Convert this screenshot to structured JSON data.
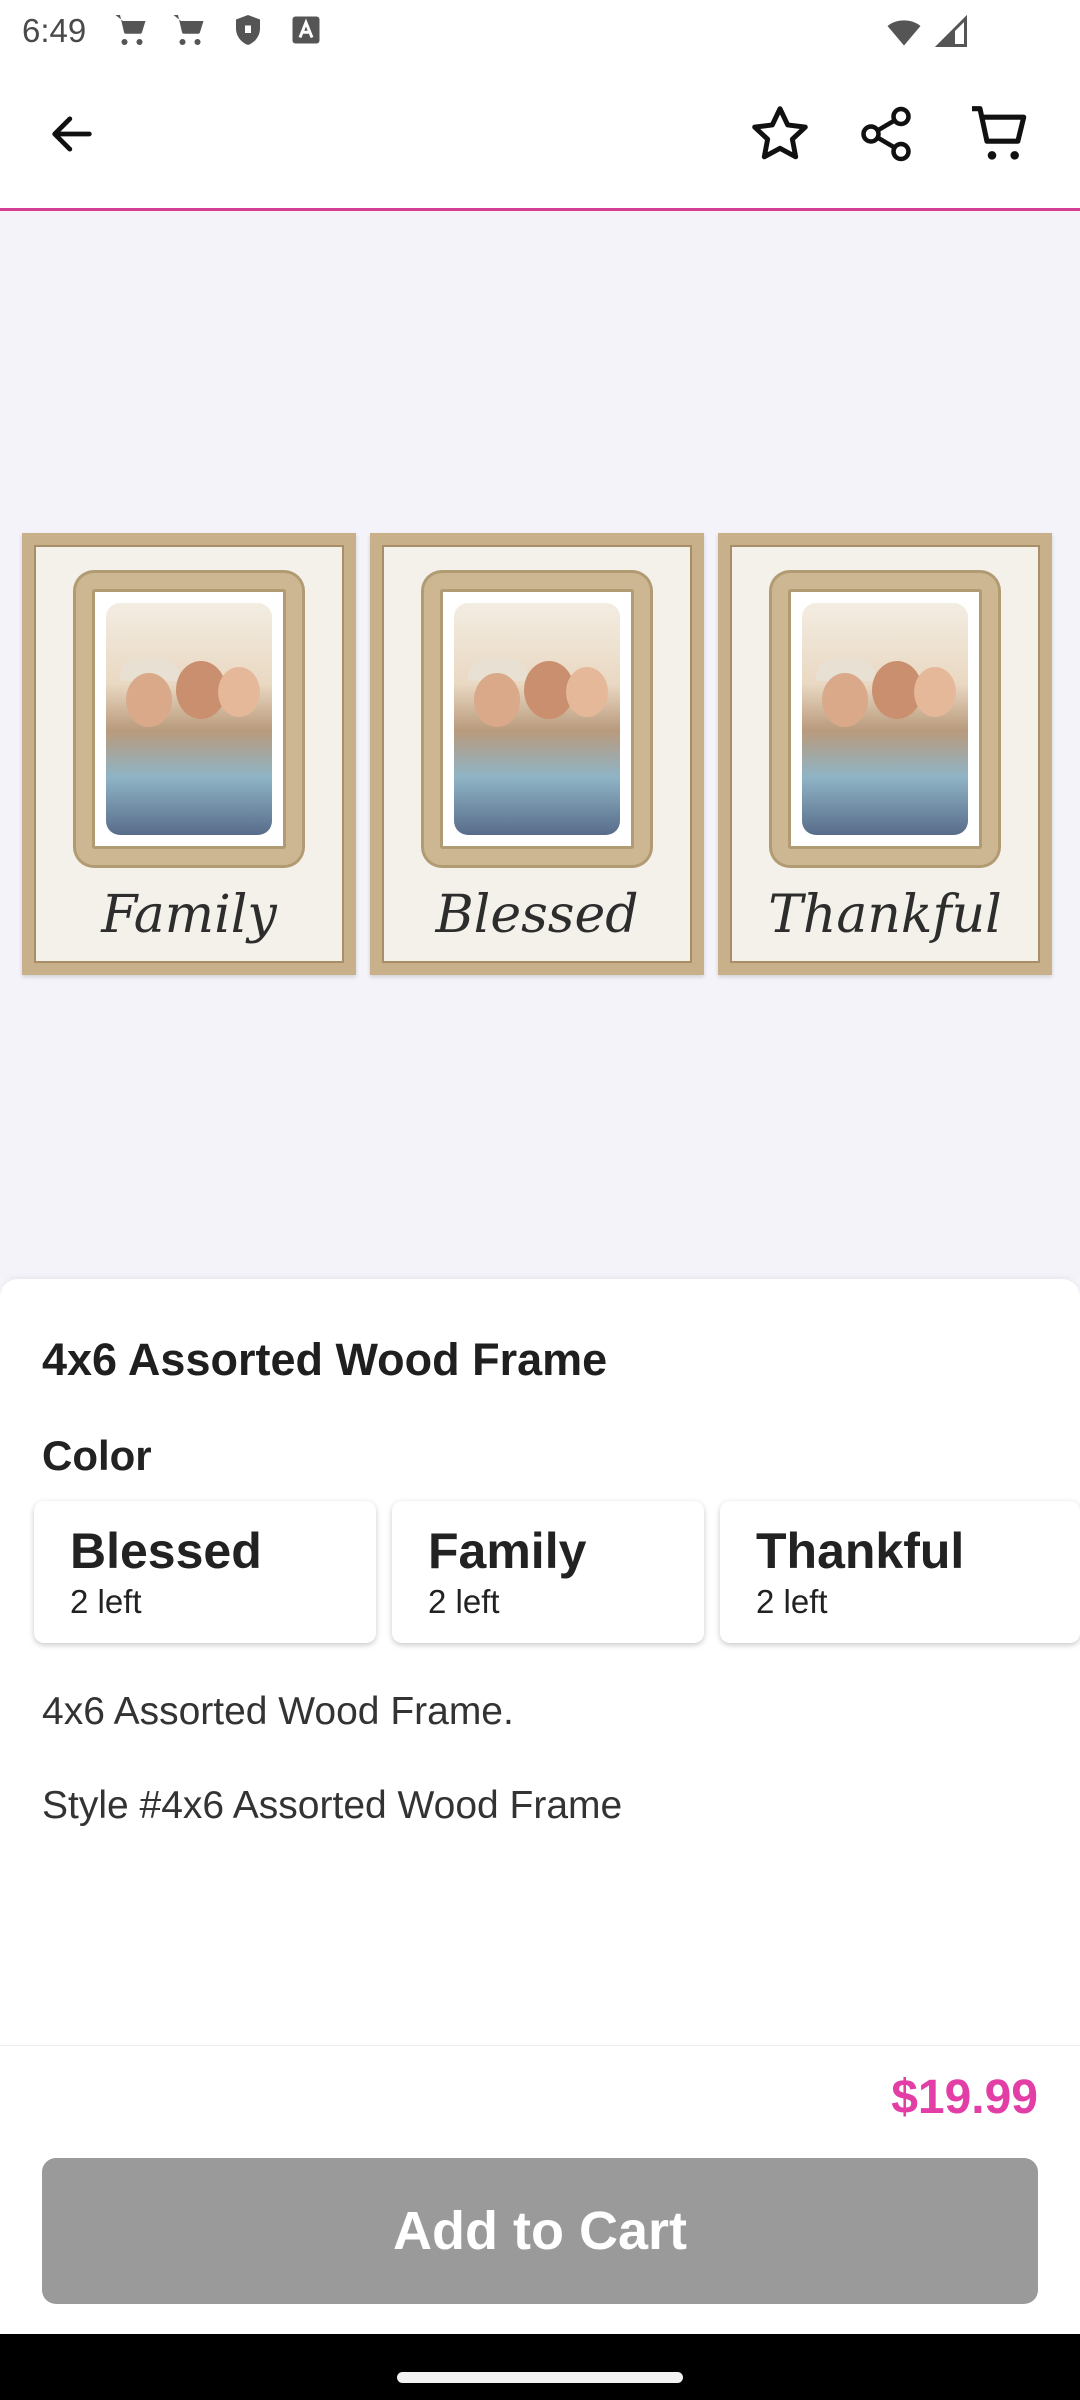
{
  "status_bar": {
    "time": "6:49",
    "left_icons": [
      "cart-icon",
      "cart-icon",
      "shield-icon",
      "a-icon"
    ],
    "right_icons": [
      "wifi-icon",
      "signal-icon"
    ]
  },
  "top_bar": {
    "icons": [
      "back-arrow-icon",
      "star-icon",
      "share-icon",
      "cart-icon"
    ],
    "accent_color": "#d43e93"
  },
  "product_image": {
    "frames": [
      {
        "script": "Family"
      },
      {
        "script": "Blessed"
      },
      {
        "script": "Thankful"
      }
    ]
  },
  "product": {
    "title": "4x6 Assorted Wood Frame",
    "color_label": "Color",
    "options": [
      {
        "name": "Blessed",
        "stock": "2 left"
      },
      {
        "name": "Family",
        "stock": "2 left"
      },
      {
        "name": "Thankful",
        "stock": "2 left"
      }
    ],
    "description": "4x6 Assorted Wood Frame.",
    "style": "Style #4x6 Assorted Wood Frame"
  },
  "purchase": {
    "price": "$19.99",
    "price_color": "#e23ea6",
    "add_to_cart_label": "Add to Cart"
  }
}
